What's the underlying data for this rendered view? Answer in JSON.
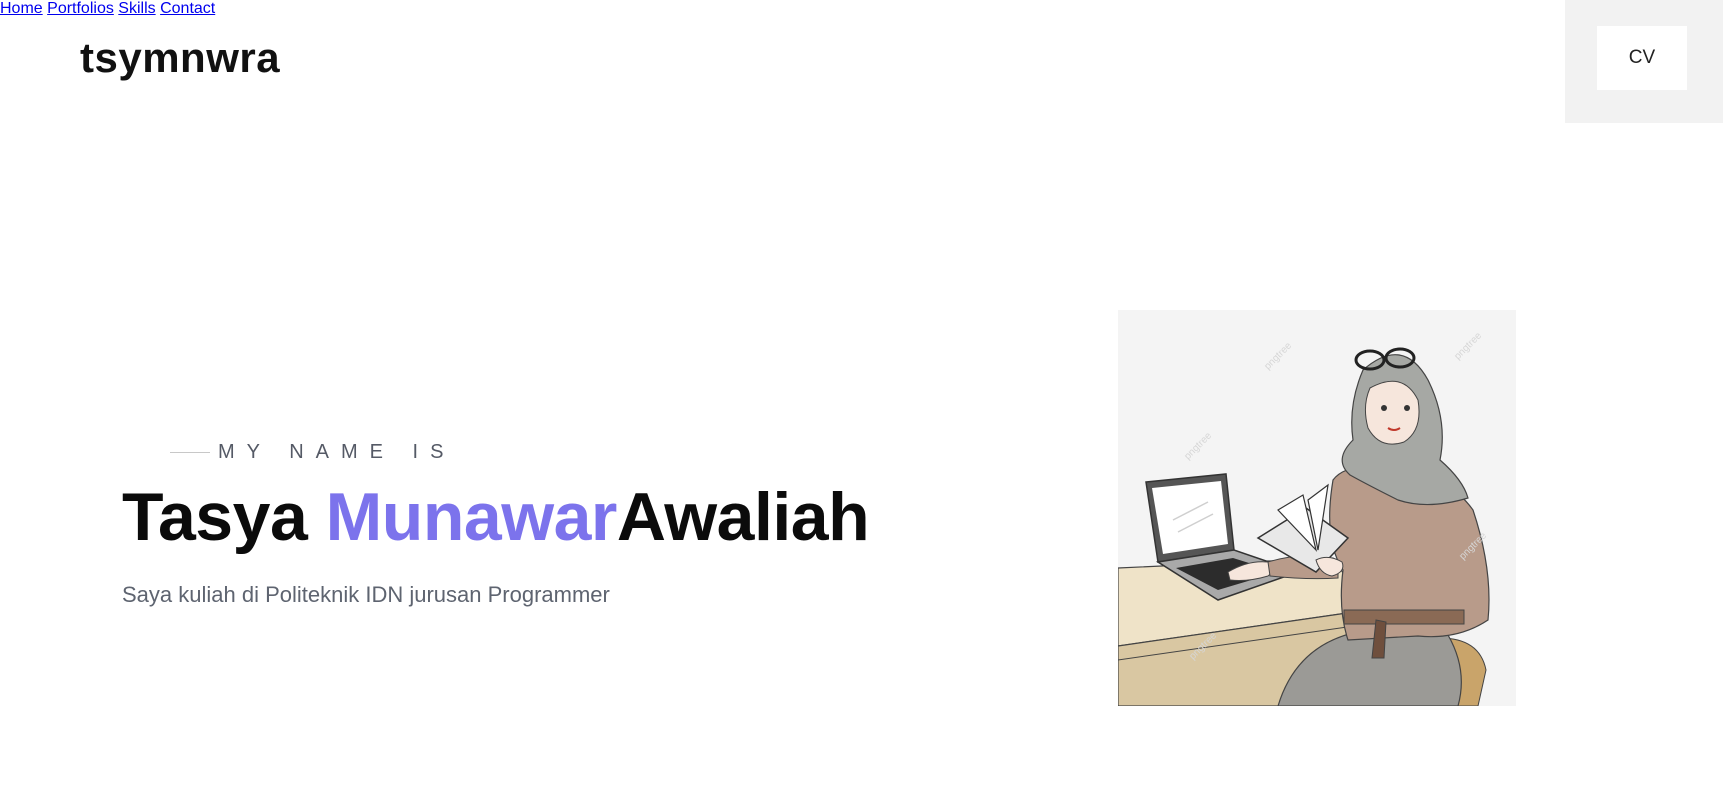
{
  "header": {
    "brand": "tsymnwra",
    "nav": [
      {
        "label": "Home"
      },
      {
        "label": "Portfolios"
      },
      {
        "label": "Skills"
      },
      {
        "label": "Contact"
      }
    ],
    "cv_label": "CV"
  },
  "hero": {
    "eyebrow": "MY NAME IS",
    "name_first": "Tasya ",
    "name_accent": "Munawar",
    "name_last": "Awaliah",
    "description": "Saya kuliah di Politeknik IDN jurusan Programmer",
    "illustration_icon": "woman-with-laptop-illustration"
  },
  "colors": {
    "nav_link": "#1a13d6",
    "accent": "#7c73ec",
    "text_dark": "#0b0b0b",
    "text_muted": "#5e6470",
    "cv_panel": "#f2f2f2"
  }
}
